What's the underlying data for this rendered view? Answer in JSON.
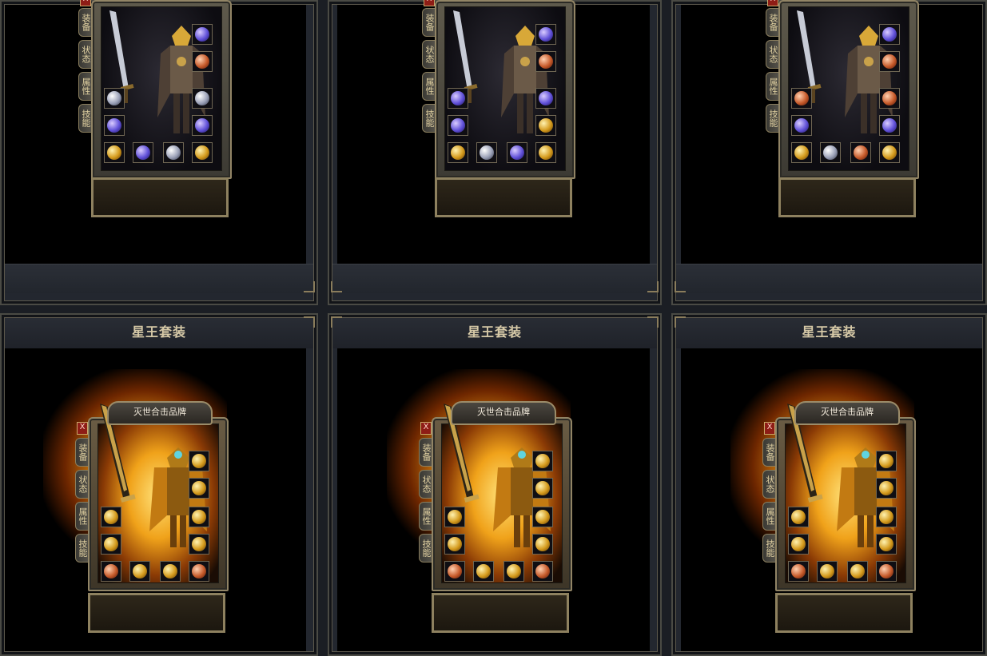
{
  "cells_top": [
    {
      "tabs": [
        "装备",
        "状态",
        "属性",
        "技能"
      ],
      "close": "X"
    },
    {
      "tabs": [
        "装备",
        "状态",
        "属性",
        "技能"
      ],
      "close": "X"
    },
    {
      "tabs": [
        "装备",
        "状态",
        "属性",
        "技能"
      ],
      "close": "X"
    }
  ],
  "cells_bottom": [
    {
      "title": "星王套装",
      "panel_header": "灭世合击品牌",
      "tabs": [
        "装备",
        "状态",
        "属性",
        "技能"
      ],
      "close": "X"
    },
    {
      "title": "星王套装",
      "panel_header": "灭世合击品牌",
      "tabs": [
        "装备",
        "状态",
        "属性",
        "技能"
      ],
      "close": "X"
    },
    {
      "title": "星王套装",
      "panel_header": "灭世合击品牌",
      "tabs": [
        "装备",
        "状态",
        "属性",
        "技能"
      ],
      "close": "X"
    }
  ],
  "colors": {
    "frame_gold": "#8e815f",
    "title_text": "#d6c9a7",
    "fire": "#ff9a14"
  },
  "icons": [
    "close-icon",
    "sword-icon",
    "ring-icon",
    "bracelet-icon",
    "necklace-icon",
    "helmet-icon",
    "medal-icon",
    "boots-icon",
    "belt-icon",
    "gem-icon"
  ]
}
